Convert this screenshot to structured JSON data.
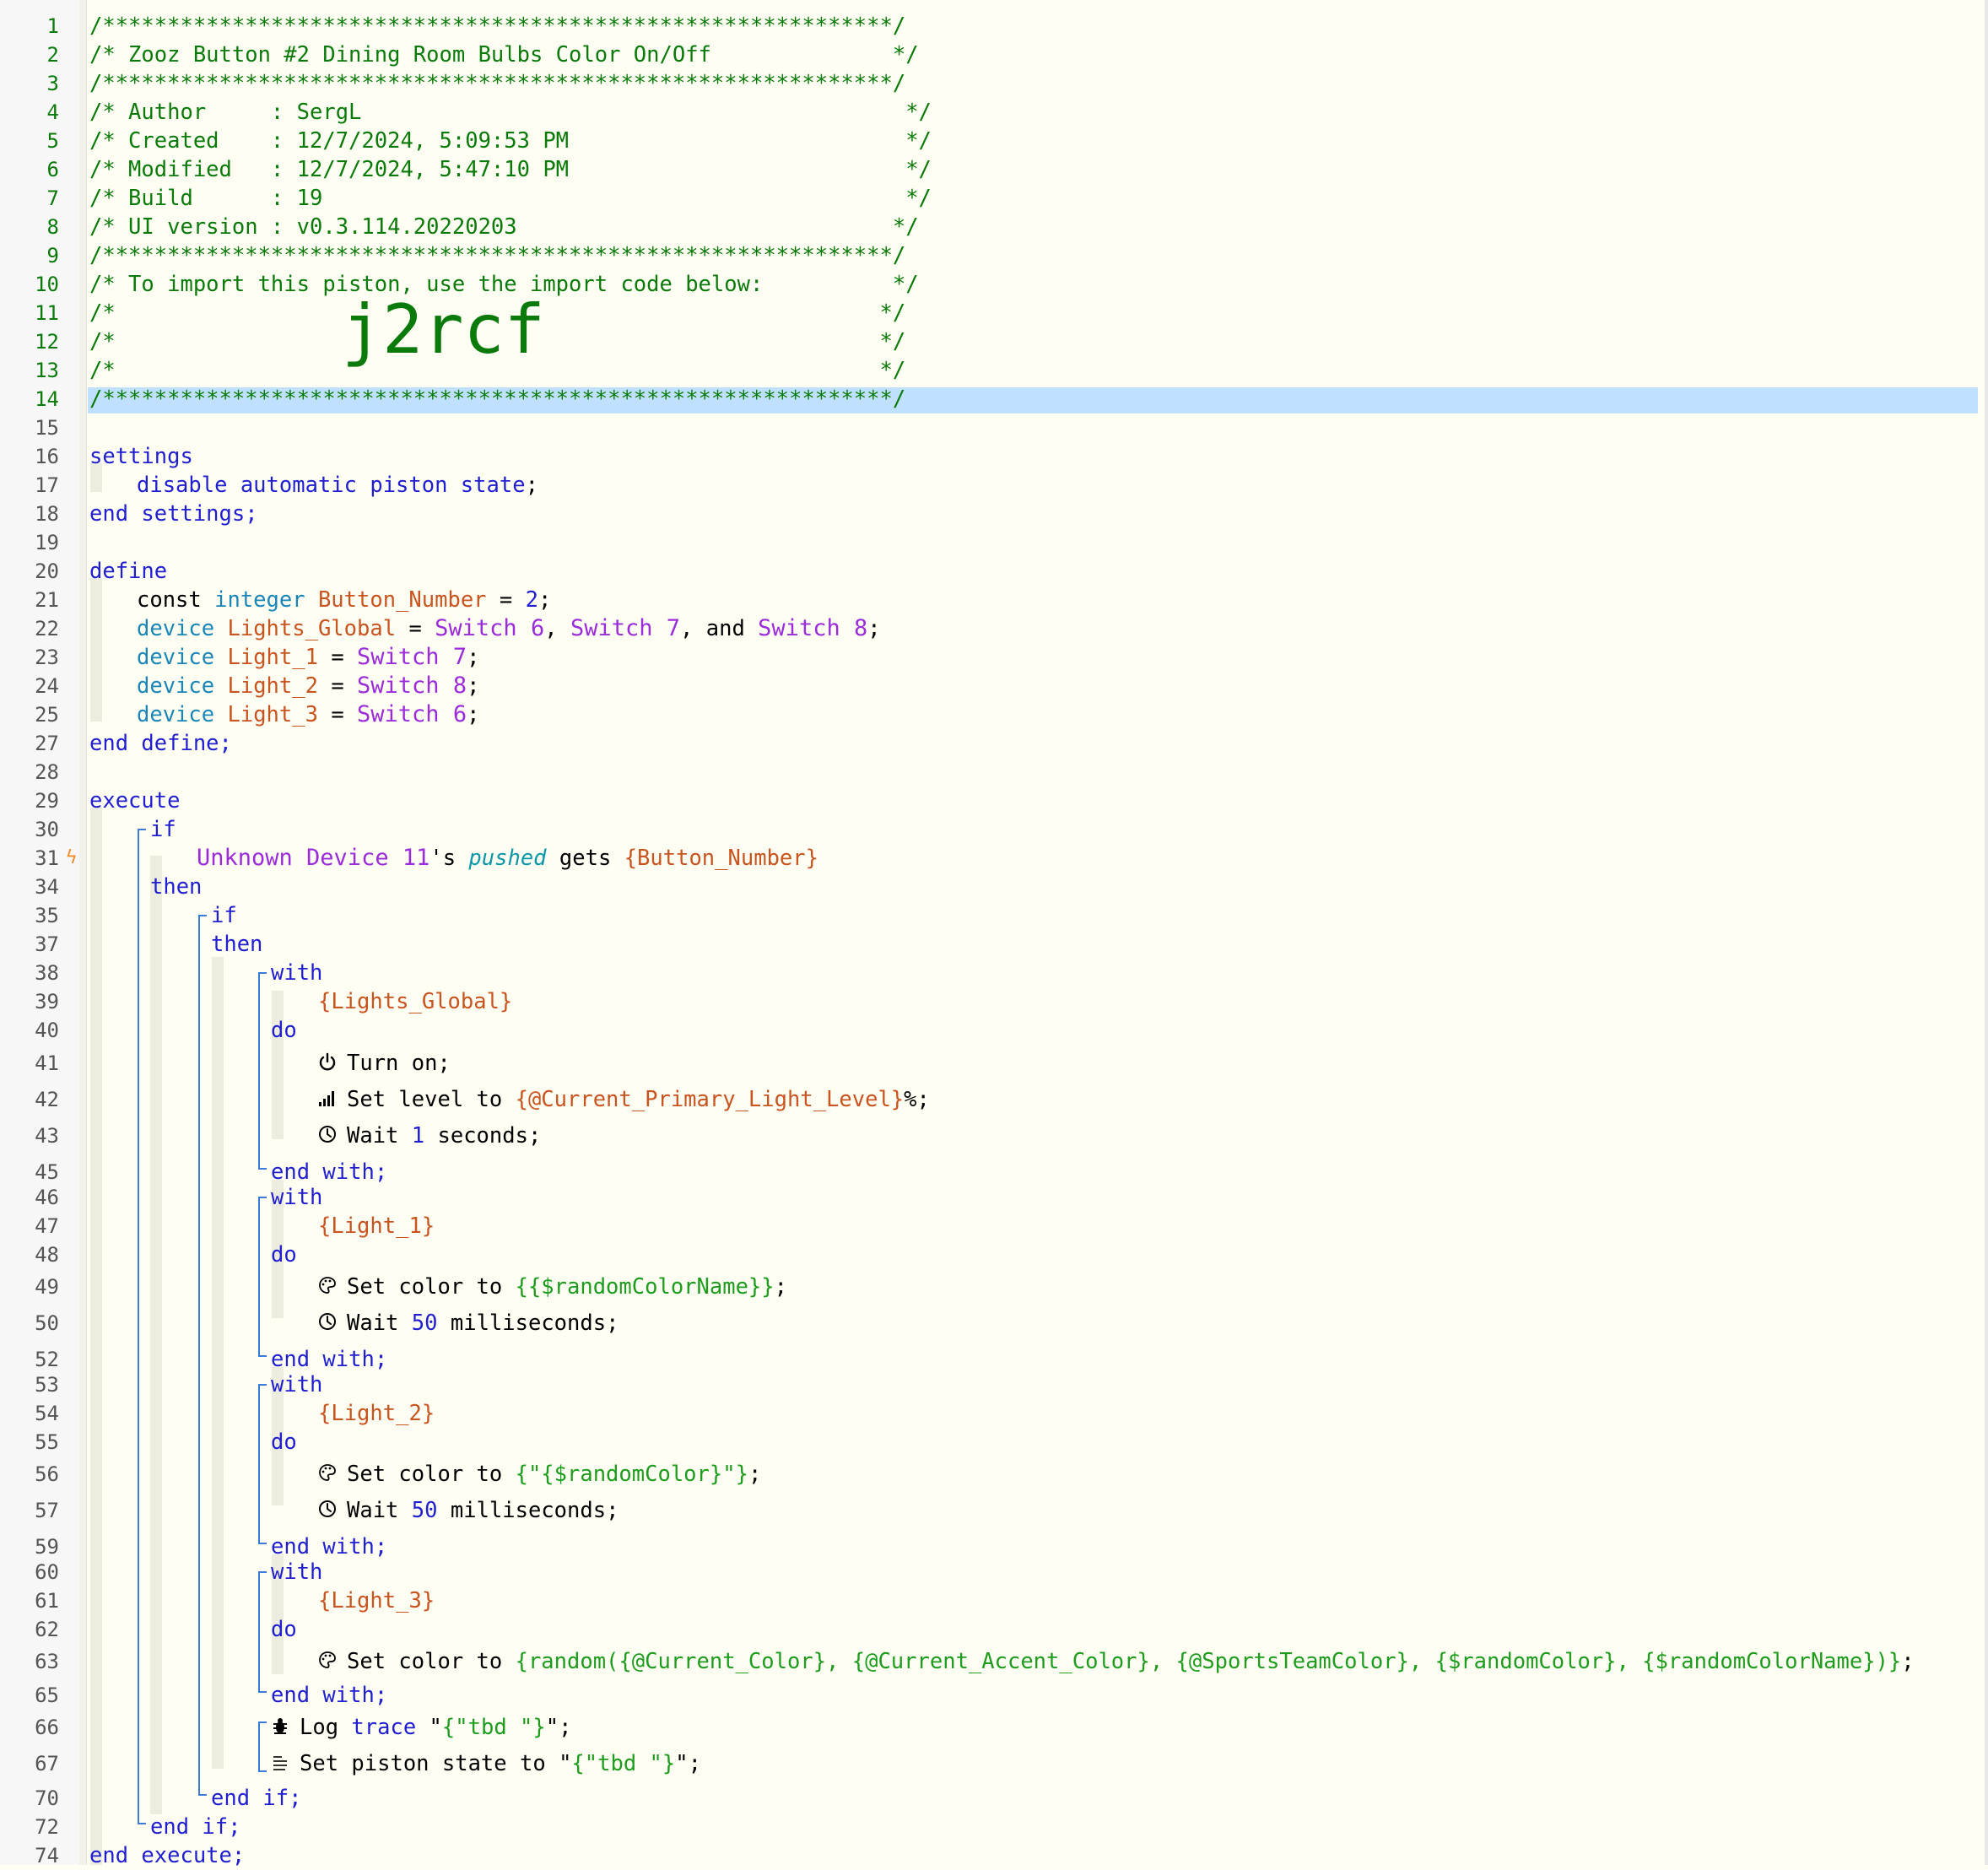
{
  "editor": {
    "line_numbers": [
      "1",
      "2",
      "3",
      "4",
      "5",
      "6",
      "7",
      "8",
      "9",
      "10",
      "11",
      "12",
      "13",
      "14",
      "15",
      "16",
      "17",
      "18",
      "19",
      "20",
      "21",
      "22",
      "23",
      "24",
      "25",
      "27",
      "28",
      "29",
      "30",
      "31",
      "34",
      "35",
      "37",
      "38",
      "39",
      "40",
      "41",
      "42",
      "43",
      "45",
      "46",
      "47",
      "48",
      "49",
      "50",
      "52",
      "53",
      "54",
      "55",
      "56",
      "57",
      "59",
      "60",
      "61",
      "62",
      "63",
      "65",
      "66",
      "67",
      "70",
      "72",
      "74"
    ],
    "header": {
      "border": "/*************************************************************/",
      "title": "/* Zooz Button #2 Dining Room Bulbs Color On/Off              */",
      "author": "/* Author     : SergL                                          */",
      "created": "/* Created    : 12/7/2024, 5:09:53 PM                          */",
      "modified": "/* Modified   : 12/7/2024, 5:47:10 PM                          */",
      "build": "/* Build      : 19                                             */",
      "ui_version": "/* UI version : v0.3.114.20220203                             */",
      "import_note": "/* To import this piston, use the import code below:          */",
      "blank_comment": "/*                                                           */",
      "comment_open": "/*",
      "comment_close": "*/",
      "import_code": "j2rcf"
    },
    "settings": {
      "open": "settings",
      "body": "disable automatic piston state",
      "semicolon": ";",
      "close": "end settings;"
    },
    "define": {
      "open": "define",
      "const_kw": "const",
      "integer_kw": "integer",
      "button_var": "Button_Number",
      "equals": "=",
      "button_value": "2",
      "device_kw": "device",
      "lights_global": "Lights_Global",
      "light_1": "Light_1",
      "light_2": "Light_2",
      "light_3": "Light_3",
      "switch_label": "Switch",
      "switch_6": "6",
      "switch_7": "7",
      "switch_8": "8",
      "comma": ",",
      "and_kw": "and",
      "close": "end define;"
    },
    "execute": {
      "open": "execute",
      "if_kw": "if",
      "then_kw": "then",
      "trigger_device": "Unknown Device 11",
      "possessive": "'s",
      "pushed_attr": "pushed",
      "gets_kw": "gets",
      "button_expr": "{Button_Number}",
      "with_kw": "with",
      "do_kw": "do",
      "end_with": "end with;",
      "end_if": "end if;",
      "close": "end execute;",
      "lights_global_expr": "{Lights_Global}",
      "light_1_expr": "{Light_1}",
      "light_2_expr": "{Light_2}",
      "light_3_expr": "{Light_3}",
      "turn_on": "Turn on;",
      "set_level_to": "Set level to",
      "level_expr": "{@Current_Primary_Light_Level}",
      "percent_semicolon": "%;",
      "wait_kw": "Wait",
      "wait_1": "1",
      "seconds": "seconds;",
      "set_color_to": "Set color to",
      "color_expr_1": "{{$randomColorName}}",
      "color_expr_2": "{\"{$randomColor}\"}",
      "color_expr_3": "{random({@Current_Color}, {@Current_Accent_Color}, {@SportsTeamColor}, {$randomColor}, {$randomColorName})}",
      "semicolon": ";",
      "wait_50": "50",
      "milliseconds": "milliseconds;",
      "log_kw": "Log",
      "trace_kw": "trace",
      "quote": "\"",
      "tbd_expr": "{\"tbd \"}",
      "quote_semicolon": "\";",
      "set_piston_state": "Set piston state to"
    },
    "icons": [
      "power-icon",
      "level-bars-icon",
      "clock-icon",
      "palette-icon",
      "bug-icon",
      "state-lines-icon"
    ],
    "colors": {
      "comment": "#0a7a0a",
      "keyword": "#1f1fd0",
      "type": "#1a86b8",
      "variable": "#c8541f",
      "device": "#9a2cd9",
      "string": "#1e9c1e",
      "highlight_line": "#bfe0ff",
      "block_bar": "#3b7bd9",
      "background": "#fffef2"
    }
  }
}
